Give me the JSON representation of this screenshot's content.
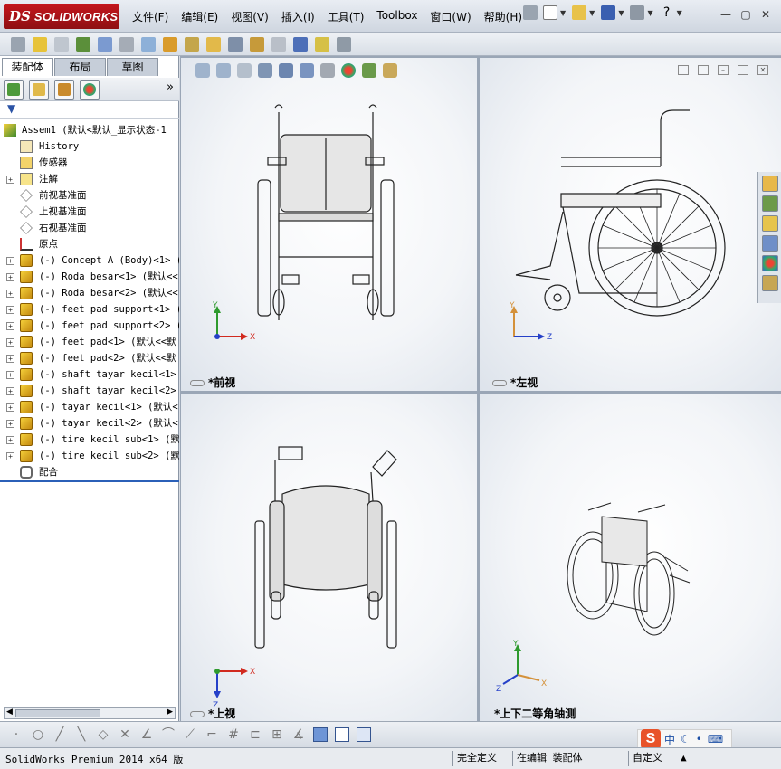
{
  "app": {
    "brand_ds": "DS",
    "brand_name": "SOLIDWORKS"
  },
  "menu": [
    "文件(F)",
    "编辑(E)",
    "视图(V)",
    "插入(I)",
    "工具(T)",
    "Toolbox",
    "窗口(W)",
    "帮助(H)"
  ],
  "panel": {
    "tabs": [
      "装配体",
      "布局",
      "草图"
    ],
    "collapse_glyph": "»",
    "filter_glyph": "▼"
  },
  "tree": [
    {
      "label": "Assem1  (默认<默认_显示状态-1",
      "icon": "assembly-icon",
      "level": 0,
      "expand": ""
    },
    {
      "label": "History",
      "icon": "history-icon",
      "level": 1,
      "expand": ""
    },
    {
      "label": "传感器",
      "icon": "sensor-icon",
      "level": 1,
      "expand": ""
    },
    {
      "label": "注解",
      "icon": "annotation-icon",
      "level": 1,
      "expand": "+"
    },
    {
      "label": "前视基准面",
      "icon": "plane-icon",
      "level": 1,
      "expand": ""
    },
    {
      "label": "上视基准面",
      "icon": "plane-icon",
      "level": 1,
      "expand": ""
    },
    {
      "label": "右视基准面",
      "icon": "plane-icon",
      "level": 1,
      "expand": ""
    },
    {
      "label": "原点",
      "icon": "origin-icon",
      "level": 1,
      "expand": ""
    },
    {
      "label": "(-) Concept A (Body)<1> (默",
      "icon": "part-icon",
      "level": 1,
      "expand": "+"
    },
    {
      "label": "(-) Roda besar<1> (默认<<",
      "icon": "part-icon",
      "level": 1,
      "expand": "+"
    },
    {
      "label": "(-) Roda besar<2> (默认<<",
      "icon": "part-icon",
      "level": 1,
      "expand": "+"
    },
    {
      "label": "(-) feet pad support<1> (",
      "icon": "part-icon",
      "level": 1,
      "expand": "+"
    },
    {
      "label": "(-) feet pad support<2> (",
      "icon": "part-icon",
      "level": 1,
      "expand": "+"
    },
    {
      "label": "(-) feet pad<1> (默认<<默",
      "icon": "part-icon",
      "level": 1,
      "expand": "+"
    },
    {
      "label": "(-) feet pad<2> (默认<<默",
      "icon": "part-icon",
      "level": 1,
      "expand": "+"
    },
    {
      "label": "(-) shaft tayar kecil<1>",
      "icon": "part-icon",
      "level": 1,
      "expand": "+"
    },
    {
      "label": "(-) shaft tayar kecil<2>",
      "icon": "part-icon",
      "level": 1,
      "expand": "+"
    },
    {
      "label": "(-) tayar kecil<1> (默认<",
      "icon": "part-icon",
      "level": 1,
      "expand": "+"
    },
    {
      "label": "(-) tayar kecil<2> (默认<",
      "icon": "part-icon",
      "level": 1,
      "expand": "+"
    },
    {
      "label": "(-) tire kecil sub<1> (默",
      "icon": "part-icon",
      "level": 1,
      "expand": "+"
    },
    {
      "label": "(-) tire kecil sub<2> (默",
      "icon": "part-icon",
      "level": 1,
      "expand": "+"
    },
    {
      "label": "配合",
      "icon": "mates-icon",
      "level": 1,
      "expand": ""
    }
  ],
  "viewports": {
    "front": {
      "label": "*前视",
      "axis1": "Y",
      "axis2": "X"
    },
    "left": {
      "label": "*左视",
      "axis1": "Y",
      "axis2": "Z"
    },
    "top": {
      "label": "*上视",
      "axis1": "X",
      "axis2": "Z"
    },
    "iso": {
      "label": "*上下二等角轴测",
      "axis1": "Y",
      "axis2": "Z",
      "axis3": "X"
    }
  },
  "ime": {
    "logo": "S",
    "lang": "中",
    "punct": "•",
    "extra": "⌨"
  },
  "status": {
    "left": "SolidWorks Premium 2014 x64 版",
    "f1": "完全定义",
    "f2": "在编辑 装配体",
    "f3": "自定义"
  },
  "colors": {
    "brand_red": "#c4161c",
    "axis_x": "#d12a1f",
    "axis_y": "#2e9a2e",
    "axis_z": "#2540c8",
    "tree_highlight": "#2b60b8"
  }
}
